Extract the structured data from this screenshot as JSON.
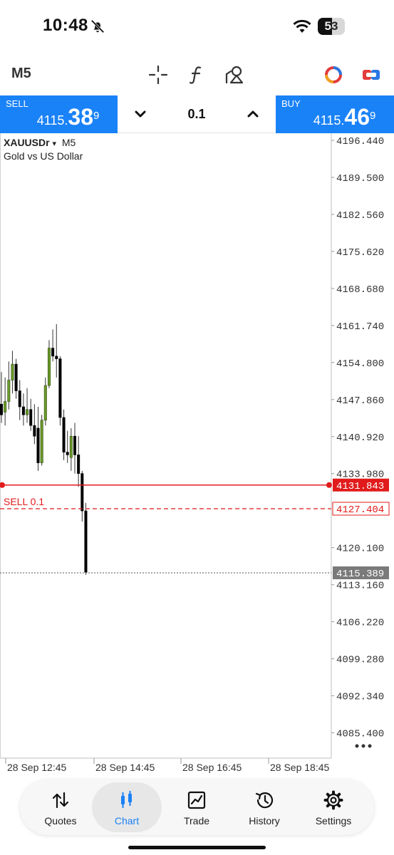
{
  "status": {
    "time": "10:48",
    "battery": "53",
    "battery_level": 0.53
  },
  "toolbar": {
    "timeframe": "M5",
    "icons": [
      "crosshair-icon",
      "indicators-icon",
      "objects-icon",
      "logo-icon",
      "one-click-trading-icon"
    ]
  },
  "trade": {
    "sell_label": "SELL",
    "sell_price_main": "4115.",
    "sell_price_big": "38",
    "sell_price_sup": "9",
    "buy_label": "BUY",
    "buy_price_main": "4115.",
    "buy_price_big": "46",
    "buy_price_sup": "9",
    "volume": "0.1"
  },
  "chart": {
    "symbol": "XAUUSDr",
    "symbol_arrow": "▾",
    "timeframe": "M5",
    "description": "Gold vs US Dollar",
    "order_line_label": "SELL 0.1"
  },
  "chart_data": {
    "type": "candlestick",
    "y_ticks": [
      "4196.440",
      "4189.500",
      "4182.560",
      "4175.620",
      "4168.680",
      "4161.740",
      "4154.800",
      "4147.860",
      "4140.920",
      "4133.980",
      "4120.100",
      "4113.160",
      "4106.220",
      "4099.280",
      "4092.340",
      "4085.400"
    ],
    "ylim": [
      4080.8,
      4196.44
    ],
    "x_ticks": [
      "28 Sep 12:45",
      "28 Sep 14:45",
      "28 Sep 16:45",
      "28 Sep 18:45"
    ],
    "price_lines": [
      {
        "label": "4131.843",
        "value": 4131.843,
        "color": "#e11b1b",
        "style": "solid"
      },
      {
        "label": "4127.404",
        "value": 4127.404,
        "color": "#e11b1b",
        "style": "dashed"
      },
      {
        "label": "4115.389",
        "value": 4115.389,
        "color": "#777777",
        "style": "dotted"
      }
    ],
    "candles": [
      {
        "o": 4147.0,
        "h": 4153.0,
        "l": 4143.5,
        "c": 4145.0
      },
      {
        "o": 4145.5,
        "h": 4152.0,
        "l": 4143.0,
        "c": 4147.5
      },
      {
        "o": 4147.5,
        "h": 4155.0,
        "l": 4146.0,
        "c": 4151.5
      },
      {
        "o": 4151.5,
        "h": 4157.0,
        "l": 4149.0,
        "c": 4154.5
      },
      {
        "o": 4154.5,
        "h": 4155.5,
        "l": 4148.0,
        "c": 4149.5
      },
      {
        "o": 4149.5,
        "h": 4151.5,
        "l": 4144.0,
        "c": 4146.5
      },
      {
        "o": 4146.5,
        "h": 4149.0,
        "l": 4143.0,
        "c": 4145.0
      },
      {
        "o": 4145.0,
        "h": 4150.0,
        "l": 4143.5,
        "c": 4146.0
      },
      {
        "o": 4146.0,
        "h": 4148.0,
        "l": 4142.0,
        "c": 4143.0
      },
      {
        "o": 4143.0,
        "h": 4147.0,
        "l": 4139.5,
        "c": 4141.0
      },
      {
        "o": 4142.5,
        "h": 4146.5,
        "l": 4134.5,
        "c": 4136.0
      },
      {
        "o": 4136.0,
        "h": 4145.0,
        "l": 4135.5,
        "c": 4144.0
      },
      {
        "o": 4144.0,
        "h": 4152.0,
        "l": 4143.0,
        "c": 4150.5
      },
      {
        "o": 4150.5,
        "h": 4159.0,
        "l": 4150.0,
        "c": 4157.5
      },
      {
        "o": 4157.5,
        "h": 4161.0,
        "l": 4155.0,
        "c": 4156.0
      },
      {
        "o": 4156.0,
        "h": 4162.0,
        "l": 4152.0,
        "c": 4155.5
      },
      {
        "o": 4155.5,
        "h": 4156.0,
        "l": 4143.0,
        "c": 4144.5
      },
      {
        "o": 4144.5,
        "h": 4146.0,
        "l": 4136.5,
        "c": 4138.0
      },
      {
        "o": 4138.0,
        "h": 4142.0,
        "l": 4136.0,
        "c": 4137.5
      },
      {
        "o": 4137.0,
        "h": 4142.5,
        "l": 4134.5,
        "c": 4141.0
      },
      {
        "o": 4141.0,
        "h": 4143.5,
        "l": 4134.0,
        "c": 4137.5
      },
      {
        "o": 4137.5,
        "h": 4141.0,
        "l": 4131.5,
        "c": 4134.0
      },
      {
        "o": 4134.0,
        "h": 4134.5,
        "l": 4125.0,
        "c": 4127.0
      },
      {
        "o": 4127.0,
        "h": 4128.5,
        "l": 4115.0,
        "c": 4115.5
      }
    ]
  },
  "nav": {
    "items": [
      {
        "label": "Quotes",
        "icon": "quotes-icon",
        "active": false
      },
      {
        "label": "Chart",
        "icon": "chart-icon",
        "active": true
      },
      {
        "label": "Trade",
        "icon": "trade-icon",
        "active": false
      },
      {
        "label": "History",
        "icon": "history-icon",
        "active": false
      },
      {
        "label": "Settings",
        "icon": "settings-icon",
        "active": false
      }
    ]
  },
  "colors": {
    "accent": "#1a82f7",
    "bull": "#6a9a2a",
    "bear": "#000000",
    "sell_line": "#e11b1b"
  }
}
